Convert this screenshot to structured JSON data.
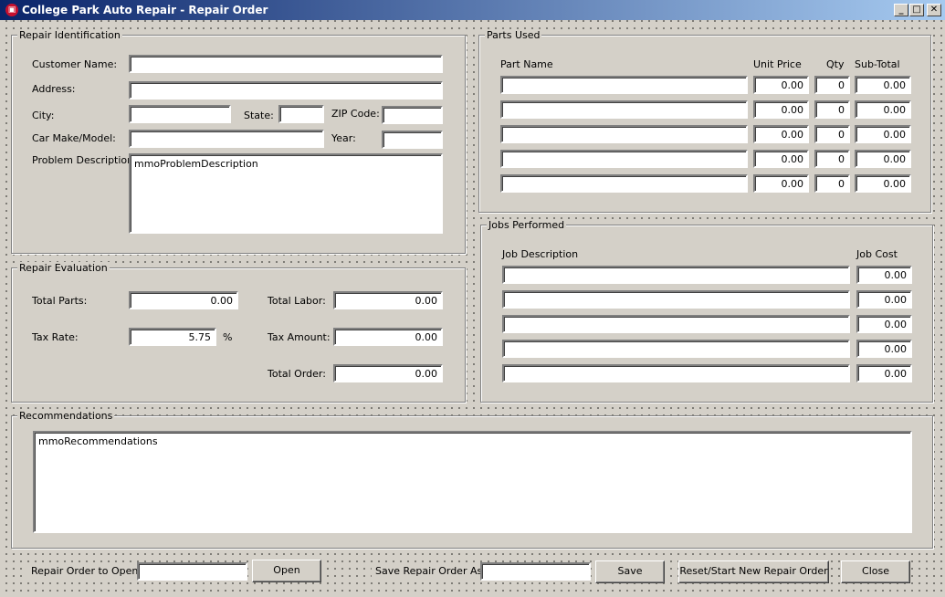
{
  "window": {
    "title": "College Park Auto Repair - Repair Order",
    "controls": [
      "minimize-icon",
      "maximize-icon",
      "close-icon"
    ]
  },
  "repair_identification": {
    "legend": "Repair Identification",
    "customer_name_label": "Customer Name:",
    "address_label": "Address:",
    "city_label": "City:",
    "state_label": "State:",
    "zip_label": "ZIP Code:",
    "make_model_label": "Car Make/Model:",
    "year_label": "Year:",
    "problem_label": "Problem Description:",
    "customer_name": "",
    "address": "",
    "city": "",
    "state": "",
    "zip": "",
    "make_model": "",
    "year": "",
    "problem_description": "mmoProblemDescription"
  },
  "parts_used": {
    "legend": "Parts Used",
    "headers": {
      "part_name": "Part Name",
      "unit_price": "Unit Price",
      "qty": "Qty",
      "subtotal": "Sub-Total"
    },
    "rows": [
      {
        "part_name": "",
        "unit_price": "0.00",
        "qty": "0",
        "subtotal": "0.00"
      },
      {
        "part_name": "",
        "unit_price": "0.00",
        "qty": "0",
        "subtotal": "0.00"
      },
      {
        "part_name": "",
        "unit_price": "0.00",
        "qty": "0",
        "subtotal": "0.00"
      },
      {
        "part_name": "",
        "unit_price": "0.00",
        "qty": "0",
        "subtotal": "0.00"
      },
      {
        "part_name": "",
        "unit_price": "0.00",
        "qty": "0",
        "subtotal": "0.00"
      }
    ]
  },
  "jobs_performed": {
    "legend": "Jobs Performed",
    "headers": {
      "description": "Job Description",
      "cost": "Job Cost"
    },
    "rows": [
      {
        "description": "",
        "cost": "0.00"
      },
      {
        "description": "",
        "cost": "0.00"
      },
      {
        "description": "",
        "cost": "0.00"
      },
      {
        "description": "",
        "cost": "0.00"
      },
      {
        "description": "",
        "cost": "0.00"
      }
    ]
  },
  "repair_evaluation": {
    "legend": "Repair Evaluation",
    "total_parts_label": "Total Parts:",
    "total_parts": "0.00",
    "tax_rate_label": "Tax Rate:",
    "tax_rate": "5.75",
    "percent": "%",
    "total_labor_label": "Total Labor:",
    "total_labor": "0.00",
    "tax_amount_label": "Tax Amount:",
    "tax_amount": "0.00",
    "total_order_label": "Total Order:",
    "total_order": "0.00"
  },
  "recommendations": {
    "legend": "Recommendations",
    "text": "mmoRecommendations"
  },
  "bottom": {
    "open_label": "Repair Order to Open:",
    "open_value": "",
    "open_button": "Open",
    "save_as_label": "Save Repair Order As:",
    "save_as_value": "",
    "save_button": "Save",
    "reset_button": "Reset/Start New Repair Order",
    "close_button": "Close"
  }
}
